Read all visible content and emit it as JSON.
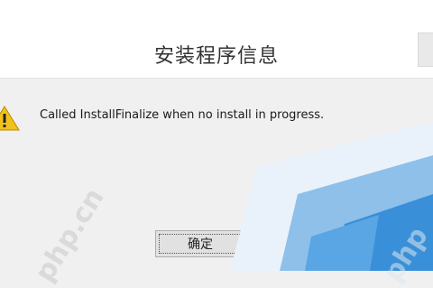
{
  "dialog": {
    "title": "安装程序信息",
    "message": "Called InstallFinalize when no install in progress.",
    "ok_label": "确定"
  },
  "icons": {
    "warning": "warning-icon",
    "close": "close-icon"
  },
  "watermarks": {
    "left": "php.cn",
    "right": "php"
  },
  "colors": {
    "dialog_bg": "#f0f0f0",
    "titlebar_bg": "#ffffff",
    "warning_yellow": "#f2c21a",
    "desktop_blue": "#3a90d8"
  }
}
